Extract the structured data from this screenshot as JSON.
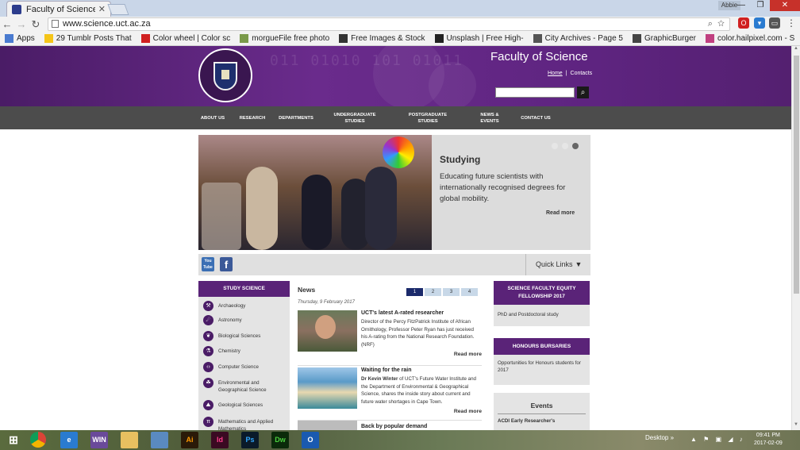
{
  "browser": {
    "tab_title": "Faculty of Science",
    "user": "Abbie",
    "url": "www.science.uct.ac.za",
    "bookmarks": [
      {
        "label": "Apps",
        "color": "#4a7bd0"
      },
      {
        "label": "29 Tumblr Posts That",
        "color": "#f5c518"
      },
      {
        "label": "Color wheel | Color sc",
        "color": "#d02020"
      },
      {
        "label": "morgueFile free photo",
        "color": "#7a9a4a"
      },
      {
        "label": "Free Images & Stock",
        "color": "#333333"
      },
      {
        "label": "Unsplash | Free High-",
        "color": "#222222"
      },
      {
        "label": "City Archives - Page 5",
        "color": "#555555"
      },
      {
        "label": "GraphicBurger",
        "color": "#444444"
      },
      {
        "label": "color.hailpixel.com - S",
        "color": "#c04080"
      }
    ]
  },
  "header": {
    "title": "Faculty of Science",
    "binary": "011 01010 101 01011",
    "links": {
      "home": "Home",
      "sep": "|",
      "contacts": "Contacts"
    },
    "search_placeholder": ""
  },
  "nav": {
    "items": [
      {
        "label": "ABOUT US"
      },
      {
        "label": "RESEARCH"
      },
      {
        "label": "DEPARTMENTS"
      },
      {
        "label": "UNDERGRADUATE STUDIES"
      },
      {
        "label": "POSTGRADUATE STUDIES"
      },
      {
        "label": "NEWS & EVENTS"
      },
      {
        "label": "CONTACT US"
      }
    ]
  },
  "hero": {
    "heading": "Studying",
    "text": "Educating future scientists with internationally recognised degrees for global mobility.",
    "more": "Read more"
  },
  "social": {
    "youtube": "You Tube",
    "facebook": "f",
    "quick_links": "Quick Links"
  },
  "study": {
    "heading": "STUDY SCIENCE",
    "items": [
      {
        "label": "Archaeology",
        "icon": "archaeology-icon",
        "glyph": "⚒"
      },
      {
        "label": "Astronomy",
        "icon": "astronomy-icon",
        "glyph": "☄"
      },
      {
        "label": "Biological Sciences",
        "icon": "biology-icon",
        "glyph": "❦"
      },
      {
        "label": "Chemistry",
        "icon": "chemistry-icon",
        "glyph": "⚗"
      },
      {
        "label": "Computer Science",
        "icon": "code-icon",
        "glyph": "‹›"
      },
      {
        "label": "Environmental and Geographical Science",
        "icon": "environment-icon",
        "glyph": "☘"
      },
      {
        "label": "Geological Sciences",
        "icon": "geology-icon",
        "glyph": "⛰"
      },
      {
        "label": "Mathematics and Applied Mathematics",
        "icon": "pi-icon",
        "glyph": "π"
      }
    ]
  },
  "news": {
    "title": "News",
    "pages": [
      "1",
      "2",
      "3",
      "4"
    ],
    "date": "Thursday, 9 February 2017",
    "stories": [
      {
        "headline": "UCT's latest A-rated researcher",
        "body": "Director of the Percy FitzPatrick Institute of African Ornithology, Professor Peter Ryan has just received his A-rating from the National Research Foundation. (NRF)",
        "more": "Read more"
      },
      {
        "headline": "Waiting for the rain",
        "author": "Dr Kevin Winter",
        "body": "of UCT's Future Water Institute and the Department of Environmental & Geographical Science, shares the inside story about current and future water shortages in Cape Town.",
        "more": "Read more"
      },
      {
        "headline": "Back by popular demand"
      }
    ]
  },
  "sidebar": {
    "equity": {
      "heading": "SCIENCE FACULTY EQUITY FELLOWSHIP 2017",
      "body": "PhD and Postdoctoral study"
    },
    "bursaries": {
      "heading": "HONOURS BURSARIES",
      "body": "Opportunities for Honours students for 2017"
    },
    "events": {
      "heading": "Events",
      "item": "ACDI Early Researcher's"
    }
  },
  "taskbar": {
    "apps": [
      {
        "name": "chrome",
        "label": "",
        "color": "#e8e8e8"
      },
      {
        "name": "internet-explorer",
        "label": "e",
        "color": "#2a7bd0"
      },
      {
        "name": "winrar",
        "label": "WIN",
        "color": "#6a4a9a"
      },
      {
        "name": "file-explorer",
        "label": "",
        "color": "#e8c060"
      },
      {
        "name": "remote-desktop",
        "label": "",
        "color": "#5a8ac0"
      },
      {
        "name": "illustrator",
        "label": "Ai",
        "color": "#2a1a08"
      },
      {
        "name": "indesign",
        "label": "Id",
        "color": "#3a0a22"
      },
      {
        "name": "photoshop",
        "label": "Ps",
        "color": "#0a1a2a"
      },
      {
        "name": "dreamweaver",
        "label": "Dw",
        "color": "#0a2a0a"
      },
      {
        "name": "outlook",
        "label": "O",
        "color": "#1a5ab0"
      }
    ],
    "desktop": "Desktop",
    "time": "09:41 PM",
    "date": "2017-02-09"
  },
  "colors": {
    "brand_purple": "#5a2378",
    "nav_gray": "#4c4c4c",
    "pager_active": "#1b2a6b"
  }
}
